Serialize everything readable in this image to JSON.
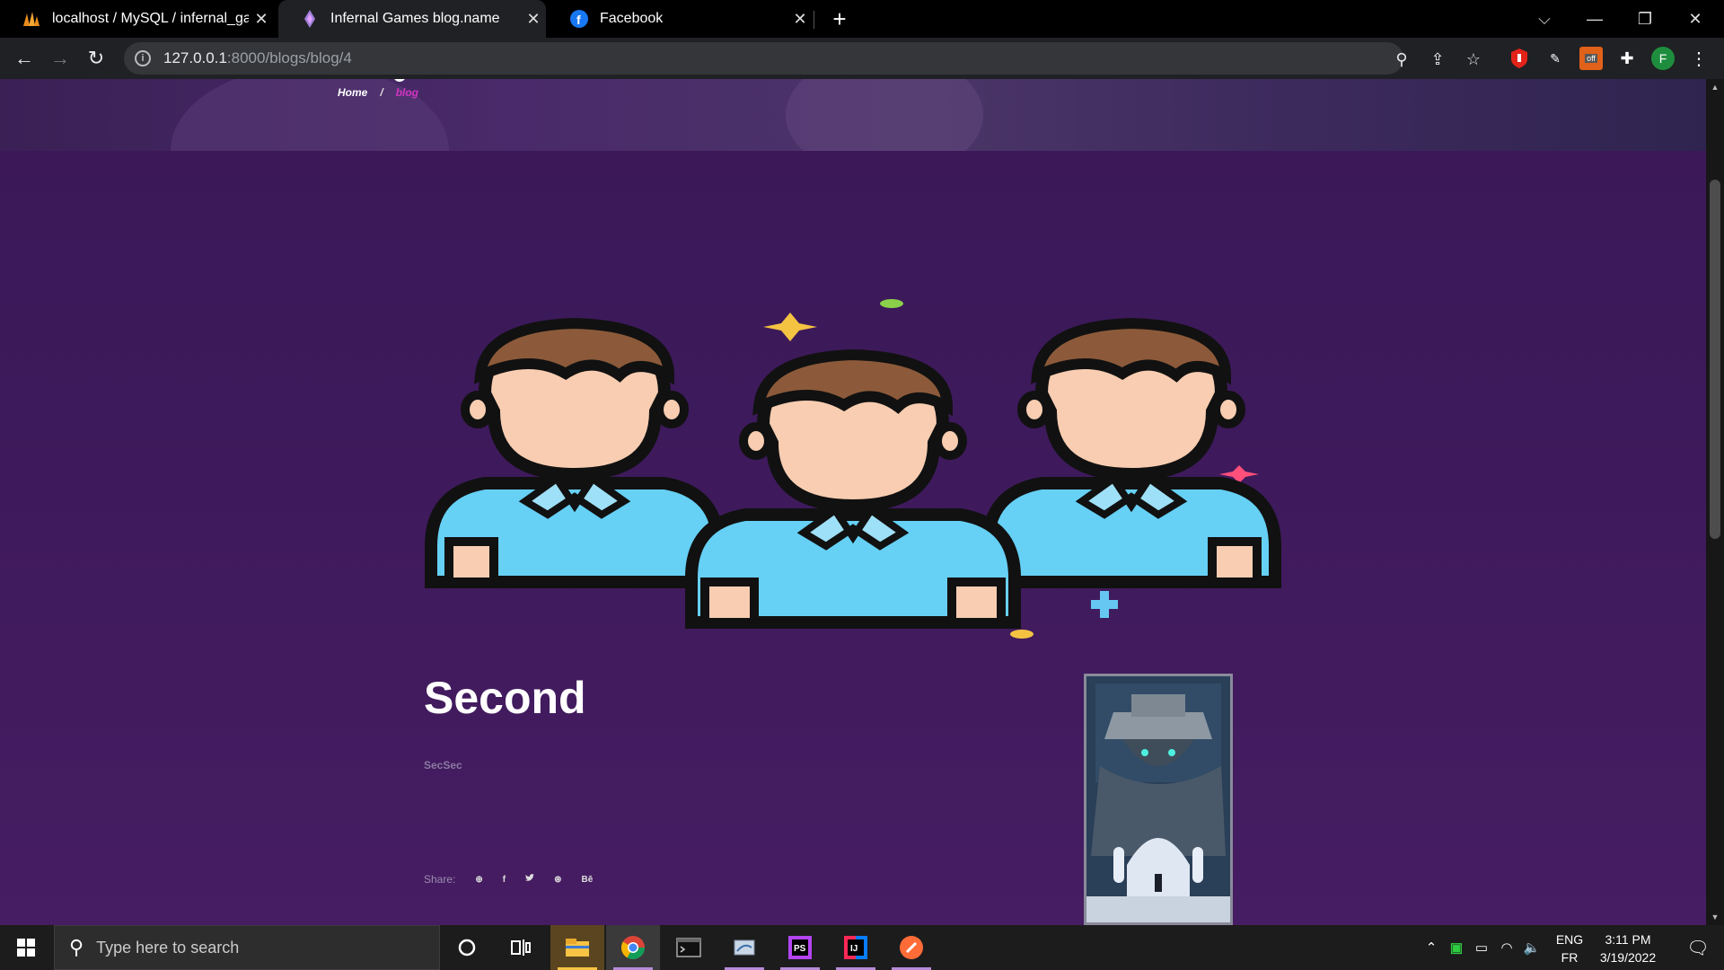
{
  "browser": {
    "tabs": [
      {
        "title": "localhost / MySQL / infernal_gam",
        "favicon": "phpmyadmin-icon"
      },
      {
        "title": "Infernal Games blog.name",
        "favicon": "site-icon"
      },
      {
        "title": "Facebook",
        "favicon": "facebook-icon"
      }
    ],
    "url_host": "127.0.0.1",
    "url_path": ":8000/blogs/blog/4",
    "profile_initial": "F",
    "ext_off_label": "off"
  },
  "page": {
    "breadcrumb": {
      "home": "Home",
      "separator": "/",
      "current": "blog"
    },
    "post": {
      "title": "Second",
      "excerpt": "SecSec"
    },
    "share": {
      "label": "Share:",
      "icons": [
        "dribbble-icon",
        "facebook-icon",
        "twitter-icon",
        "dribbble-icon",
        "behance-icon"
      ],
      "glyphs": [
        "⊕",
        "f",
        "🐦",
        "⊛",
        "Bē"
      ]
    },
    "colors": {
      "accent": "#d233c2",
      "background": "#3b1858"
    }
  },
  "taskbar": {
    "search_placeholder": "Type here to search",
    "lang_top": "ENG",
    "lang_bottom": "FR",
    "time": "3:11 PM",
    "date": "3/19/2022"
  }
}
